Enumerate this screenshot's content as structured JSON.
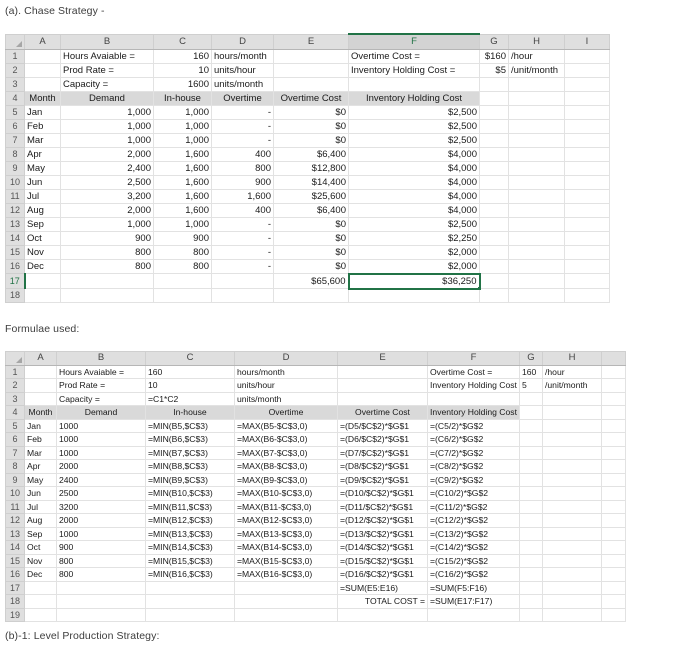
{
  "captions": {
    "top": "(a). Chase Strategy -",
    "middle": "Formulae used:",
    "bottom": "(b)-1: Level Production Strategy:"
  },
  "values_sheet": {
    "column_letters": [
      "A",
      "B",
      "C",
      "D",
      "E",
      "F",
      "G",
      "H",
      "I"
    ],
    "selected_column": "F",
    "selected_row": "17",
    "selected_cell": "F17",
    "row_numbers": [
      "1",
      "2",
      "3",
      "4",
      "5",
      "6",
      "7",
      "8",
      "9",
      "10",
      "11",
      "12",
      "13",
      "14",
      "15",
      "16",
      "17",
      "18"
    ],
    "parameters": [
      {
        "row": "1",
        "label": "Hours Avaiable =",
        "value": "160",
        "unit": "hours/month"
      },
      {
        "row": "2",
        "label": "Prod Rate =",
        "value": "10",
        "unit": "units/hour"
      },
      {
        "row": "3",
        "label": "Capacity =",
        "value": "1600",
        "unit": "units/month"
      }
    ],
    "rates": [
      {
        "row": "1",
        "label": "Overtime Cost =",
        "value": "$160",
        "unit": "/hour"
      },
      {
        "row": "2",
        "label": "Inventory Holding Cost =",
        "value": "$5",
        "unit": "/unit/month"
      }
    ],
    "headers": [
      "Month",
      "Demand",
      "In-house",
      "Overtime",
      "Overtime Cost",
      "Inventory Holding Cost"
    ],
    "rows": [
      {
        "row": "5",
        "month": "Jan",
        "demand": "1,000",
        "inhouse": "1,000",
        "overtime": "-",
        "overtime_cost": "$0",
        "holding_cost": "$2,500"
      },
      {
        "row": "6",
        "month": "Feb",
        "demand": "1,000",
        "inhouse": "1,000",
        "overtime": "-",
        "overtime_cost": "$0",
        "holding_cost": "$2,500"
      },
      {
        "row": "7",
        "month": "Mar",
        "demand": "1,000",
        "inhouse": "1,000",
        "overtime": "-",
        "overtime_cost": "$0",
        "holding_cost": "$2,500"
      },
      {
        "row": "8",
        "month": "Apr",
        "demand": "2,000",
        "inhouse": "1,600",
        "overtime": "400",
        "overtime_cost": "$6,400",
        "holding_cost": "$4,000"
      },
      {
        "row": "9",
        "month": "May",
        "demand": "2,400",
        "inhouse": "1,600",
        "overtime": "800",
        "overtime_cost": "$12,800",
        "holding_cost": "$4,000"
      },
      {
        "row": "10",
        "month": "Jun",
        "demand": "2,500",
        "inhouse": "1,600",
        "overtime": "900",
        "overtime_cost": "$14,400",
        "holding_cost": "$4,000"
      },
      {
        "row": "11",
        "month": "Jul",
        "demand": "3,200",
        "inhouse": "1,600",
        "overtime": "1,600",
        "overtime_cost": "$25,600",
        "holding_cost": "$4,000"
      },
      {
        "row": "12",
        "month": "Aug",
        "demand": "2,000",
        "inhouse": "1,600",
        "overtime": "400",
        "overtime_cost": "$6,400",
        "holding_cost": "$4,000"
      },
      {
        "row": "13",
        "month": "Sep",
        "demand": "1,000",
        "inhouse": "1,000",
        "overtime": "-",
        "overtime_cost": "$0",
        "holding_cost": "$2,500"
      },
      {
        "row": "14",
        "month": "Oct",
        "demand": "900",
        "inhouse": "900",
        "overtime": "-",
        "overtime_cost": "$0",
        "holding_cost": "$2,250"
      },
      {
        "row": "15",
        "month": "Nov",
        "demand": "800",
        "inhouse": "800",
        "overtime": "-",
        "overtime_cost": "$0",
        "holding_cost": "$2,000"
      },
      {
        "row": "16",
        "month": "Dec",
        "demand": "800",
        "inhouse": "800",
        "overtime": "-",
        "overtime_cost": "$0",
        "holding_cost": "$2,000"
      }
    ],
    "totals": {
      "row": "17",
      "overtime_cost": "$65,600",
      "holding_cost": "$36,250"
    }
  },
  "formulae_sheet": {
    "column_letters": [
      "A",
      "B",
      "C",
      "D",
      "E",
      "F",
      "G",
      "H"
    ],
    "row_numbers": [
      "1",
      "2",
      "3",
      "4",
      "5",
      "6",
      "7",
      "8",
      "9",
      "10",
      "11",
      "12",
      "13",
      "14",
      "15",
      "16",
      "17",
      "18",
      "19"
    ],
    "parameters": [
      {
        "row": "1",
        "label": "Hours Avaiable =",
        "value": "160",
        "unit": "hours/month"
      },
      {
        "row": "2",
        "label": "Prod Rate =",
        "value": "10",
        "unit": "units/hour"
      },
      {
        "row": "3",
        "label": "Capacity =",
        "value": "=C1*C2",
        "unit": "units/month"
      }
    ],
    "rates": [
      {
        "row": "1",
        "label": "Overtime Cost =",
        "value": "160",
        "unit": "/hour"
      },
      {
        "row": "2",
        "label": "Inventory Holding Cost =",
        "value": "5",
        "unit": "/unit/month"
      }
    ],
    "headers": [
      "Month",
      "Demand",
      "In-house",
      "Overtime",
      "Overtime Cost",
      "Inventory Holding Cost"
    ],
    "rows": [
      {
        "row": "5",
        "month": "Jan",
        "demand": "1000",
        "inhouse": "=MIN(B5,$C$3)",
        "overtime": "=MAX(B5-$C$3,0)",
        "overtime_cost": "=(D5/$C$2)*$G$1",
        "holding_cost": "=(C5/2)*$G$2"
      },
      {
        "row": "6",
        "month": "Feb",
        "demand": "1000",
        "inhouse": "=MIN(B6,$C$3)",
        "overtime": "=MAX(B6-$C$3,0)",
        "overtime_cost": "=(D6/$C$2)*$G$1",
        "holding_cost": "=(C6/2)*$G$2"
      },
      {
        "row": "7",
        "month": "Mar",
        "demand": "1000",
        "inhouse": "=MIN(B7,$C$3)",
        "overtime": "=MAX(B7-$C$3,0)",
        "overtime_cost": "=(D7/$C$2)*$G$1",
        "holding_cost": "=(C7/2)*$G$2"
      },
      {
        "row": "8",
        "month": "Apr",
        "demand": "2000",
        "inhouse": "=MIN(B8,$C$3)",
        "overtime": "=MAX(B8-$C$3,0)",
        "overtime_cost": "=(D8/$C$2)*$G$1",
        "holding_cost": "=(C8/2)*$G$2"
      },
      {
        "row": "9",
        "month": "May",
        "demand": "2400",
        "inhouse": "=MIN(B9,$C$3)",
        "overtime": "=MAX(B9-$C$3,0)",
        "overtime_cost": "=(D9/$C$2)*$G$1",
        "holding_cost": "=(C9/2)*$G$2"
      },
      {
        "row": "10",
        "month": "Jun",
        "demand": "2500",
        "inhouse": "=MIN(B10,$C$3)",
        "overtime": "=MAX(B10-$C$3,0)",
        "overtime_cost": "=(D10/$C$2)*$G$1",
        "holding_cost": "=(C10/2)*$G$2"
      },
      {
        "row": "11",
        "month": "Jul",
        "demand": "3200",
        "inhouse": "=MIN(B11,$C$3)",
        "overtime": "=MAX(B11-$C$3,0)",
        "overtime_cost": "=(D11/$C$2)*$G$1",
        "holding_cost": "=(C11/2)*$G$2"
      },
      {
        "row": "12",
        "month": "Aug",
        "demand": "2000",
        "inhouse": "=MIN(B12,$C$3)",
        "overtime": "=MAX(B12-$C$3,0)",
        "overtime_cost": "=(D12/$C$2)*$G$1",
        "holding_cost": "=(C12/2)*$G$2"
      },
      {
        "row": "13",
        "month": "Sep",
        "demand": "1000",
        "inhouse": "=MIN(B13,$C$3)",
        "overtime": "=MAX(B13-$C$3,0)",
        "overtime_cost": "=(D13/$C$2)*$G$1",
        "holding_cost": "=(C13/2)*$G$2"
      },
      {
        "row": "14",
        "month": "Oct",
        "demand": "900",
        "inhouse": "=MIN(B14,$C$3)",
        "overtime": "=MAX(B14-$C$3,0)",
        "overtime_cost": "=(D14/$C$2)*$G$1",
        "holding_cost": "=(C14/2)*$G$2"
      },
      {
        "row": "15",
        "month": "Nov",
        "demand": "800",
        "inhouse": "=MIN(B15,$C$3)",
        "overtime": "=MAX(B15-$C$3,0)",
        "overtime_cost": "=(D15/$C$2)*$G$1",
        "holding_cost": "=(C15/2)*$G$2"
      },
      {
        "row": "16",
        "month": "Dec",
        "demand": "800",
        "inhouse": "=MIN(B16,$C$3)",
        "overtime": "=MAX(B16-$C$3,0)",
        "overtime_cost": "=(D16/$C$2)*$G$1",
        "holding_cost": "=(C16/2)*$G$2"
      }
    ],
    "subtotals": {
      "row": "17",
      "overtime_cost": "=SUM(E5:E16)",
      "holding_cost": "=SUM(F5:F16)"
    },
    "total": {
      "row": "18",
      "label": "TOTAL COST =",
      "formula": "=SUM(E17:F17)"
    }
  },
  "colors": {
    "selection_green": "#217346",
    "header_grey": "#d9d9d9",
    "gutter_grey": "#dfdfdf",
    "gridline": "#e2e2e2",
    "box_border": "#4a4a4a"
  }
}
